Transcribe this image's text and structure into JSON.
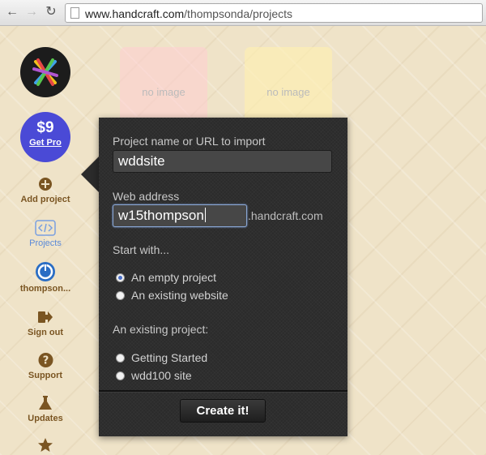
{
  "browser": {
    "url_host": "www.handcraft.com",
    "url_path": "/thompsonda/projects"
  },
  "sidebar": {
    "pro": {
      "price": "$9",
      "label": "Get Pro"
    },
    "items": [
      {
        "label": "Add project",
        "icon": "plus-circle-icon"
      },
      {
        "label": "Projects",
        "icon": "code-brackets-icon"
      },
      {
        "label": "thompson...",
        "icon": "user-avatar-icon"
      },
      {
        "label": "Sign out",
        "icon": "sign-out-icon"
      },
      {
        "label": "Support",
        "icon": "question-icon"
      },
      {
        "label": "Updates",
        "icon": "flask-icon"
      }
    ]
  },
  "projects": [
    {
      "placeholder": "no image"
    },
    {
      "placeholder": "no image"
    }
  ],
  "popover": {
    "project_name_label": "Project name or URL to import",
    "project_name_value": "wddsite",
    "web_address_label": "Web address",
    "web_address_value": "w15thompson",
    "domain_suffix": ".handcraft.com",
    "start_with_label": "Start with...",
    "start_options": [
      {
        "label": "An empty project",
        "checked": true
      },
      {
        "label": "An existing website",
        "checked": false
      }
    ],
    "existing_project_label": "An existing project:",
    "existing_options": [
      {
        "label": "Getting Started",
        "checked": false
      },
      {
        "label": "wdd100 site",
        "checked": false
      }
    ],
    "create_button": "Create it!"
  }
}
